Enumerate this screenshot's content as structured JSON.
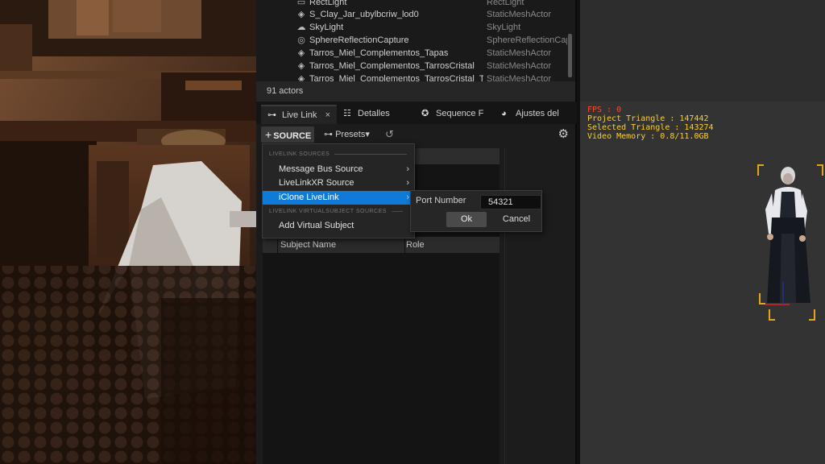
{
  "outliner": {
    "rows": [
      {
        "icon": "rect-light-icon",
        "glyph": "▭",
        "name": "RectLight",
        "type": "RectLight"
      },
      {
        "icon": "mesh-icon",
        "glyph": "◈",
        "name": "S_Clay_Jar_ubylbcriw_lod0",
        "type": "StaticMeshActor"
      },
      {
        "icon": "skylight-icon",
        "glyph": "☁",
        "name": "SkyLight",
        "type": "SkyLight"
      },
      {
        "icon": "reflection-capture-icon",
        "glyph": "◎",
        "name": "SphereReflectionCapture",
        "type": "SphereReflectionCap"
      },
      {
        "icon": "mesh-icon",
        "glyph": "◈",
        "name": "Tarros_Miel_Complementos_Tapas",
        "type": "StaticMeshActor"
      },
      {
        "icon": "mesh-icon",
        "glyph": "◈",
        "name": "Tarros_Miel_Complementos_TarrosCristal",
        "type": "StaticMeshActor"
      },
      {
        "icon": "mesh-icon",
        "glyph": "◈",
        "name": "Tarros_Miel_Complementos_TarrosCristal_Tar",
        "type": "StaticMeshActor"
      }
    ],
    "actor_count": "91 actors"
  },
  "tabs": [
    {
      "label": "Live Link",
      "icon": "livelink-icon",
      "glyph": "⊶"
    },
    {
      "label": "Detalles",
      "icon": "details-icon",
      "glyph": "☷"
    },
    {
      "label": "Sequence F",
      "icon": "sequencer-icon",
      "glyph": "✪"
    },
    {
      "label": "Ajustes del",
      "icon": "world-settings-icon",
      "glyph": "◕"
    }
  ],
  "tab_close": "×",
  "toolbar": {
    "source_label": "SOURCE",
    "source_plus": "+",
    "presets_label": "Presets",
    "presets_icon": "⊶",
    "refresh_glyph": "↺",
    "settings_glyph": "⚙"
  },
  "menu": {
    "section1": "LIVELINK SOURCES",
    "items": [
      {
        "label": "Message Bus Source",
        "has_submenu": true
      },
      {
        "label": "LiveLinkXR Source",
        "has_submenu": true
      },
      {
        "label": "iClone LiveLink",
        "has_submenu": true,
        "highlighted": true
      }
    ],
    "section2": "LIVELINK VIRTUALSUBJECT SOURCES",
    "virtual_item": "Add Virtual Subject",
    "arrow": "›"
  },
  "port_dialog": {
    "label": "Port Number",
    "value": "54321",
    "ok_label": "Ok",
    "cancel_label": "Cancel"
  },
  "subjects": {
    "col_name": "Subject Name",
    "col_role": "Role"
  },
  "stats": {
    "fps": "FPS : 0",
    "project_triangle": "Project Triangle : 147442",
    "selected_triangle": "Selected Triangle : 143274",
    "video_memory": "Video Memory : 0.8/11.0GB"
  },
  "colors": {
    "highlight": "#0f7ad8",
    "fps": "#ff4a2a",
    "stats": "#ffcf2a",
    "selection_brackets": "#e3a51a"
  }
}
